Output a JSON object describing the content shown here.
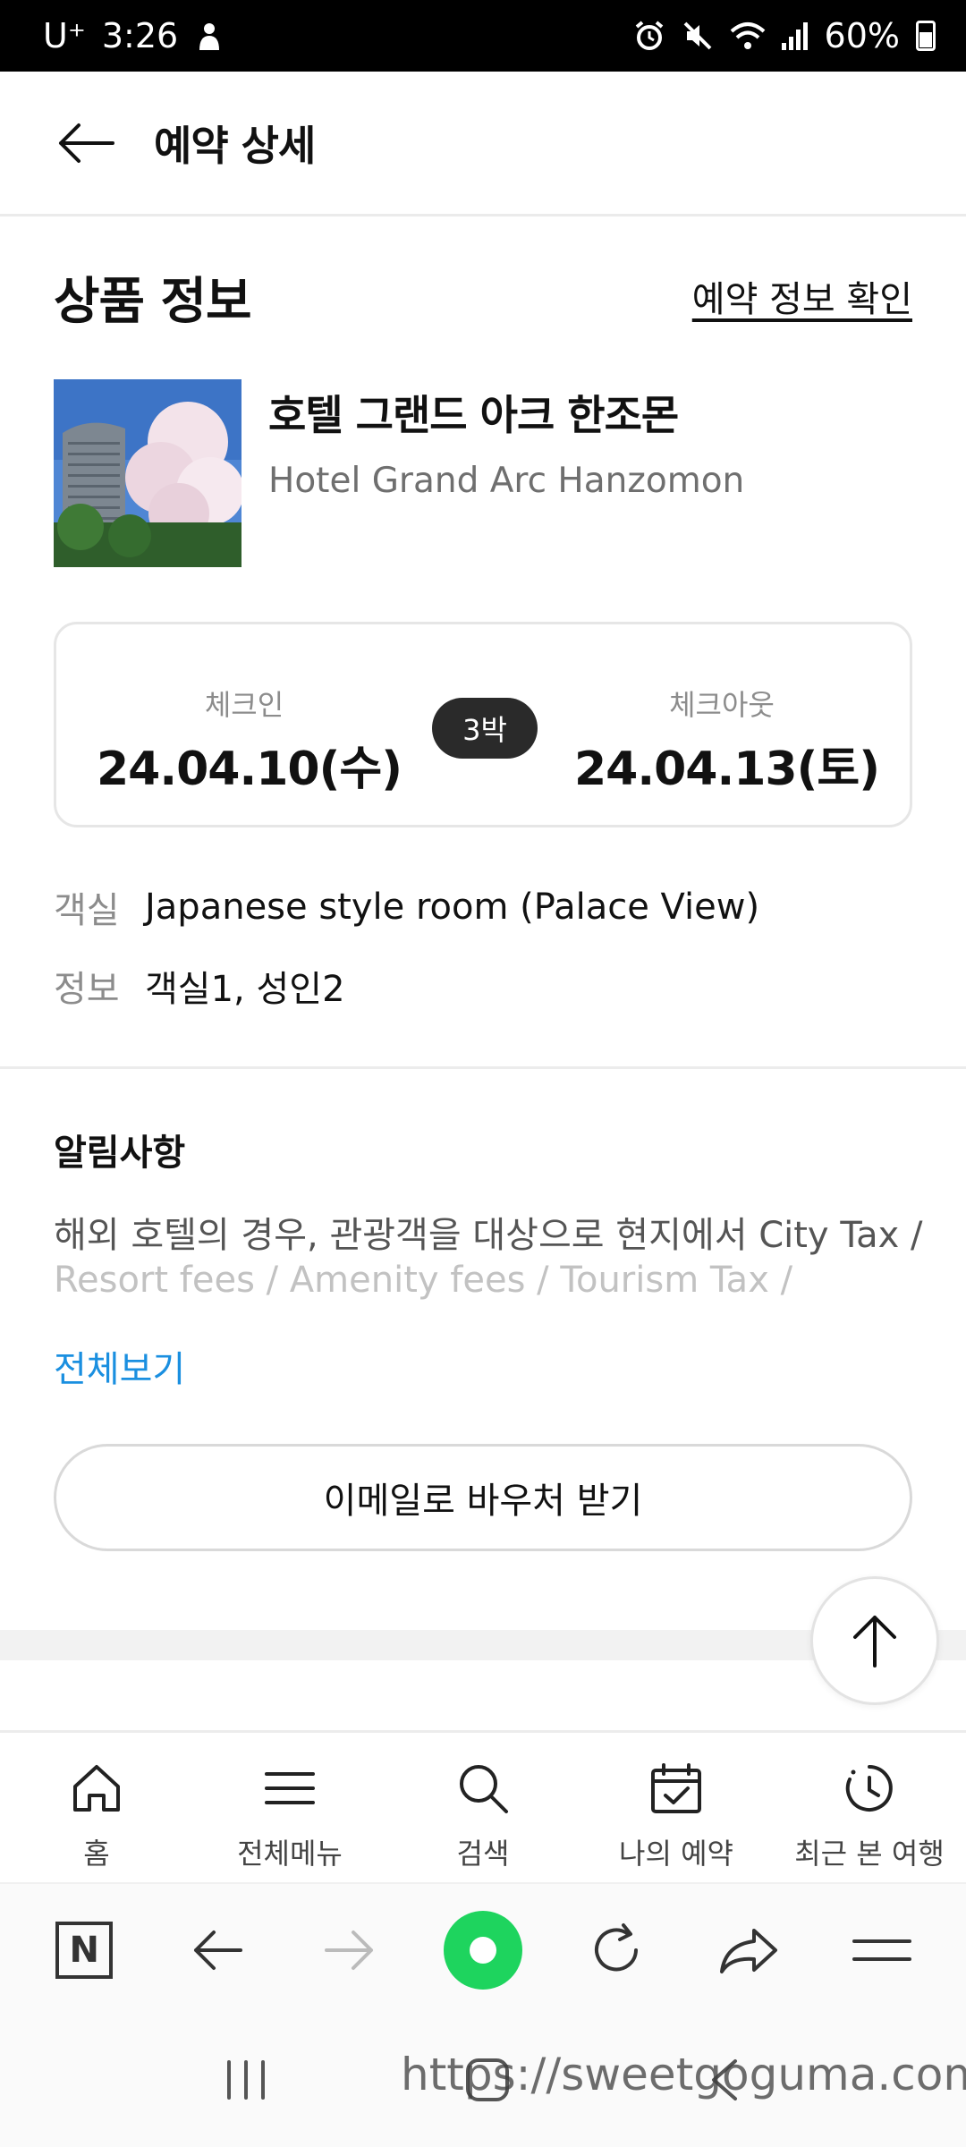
{
  "status_bar": {
    "carrier": "U⁺",
    "time": "3:26",
    "battery": "60%"
  },
  "header": {
    "title": "예약 상세"
  },
  "product": {
    "section_title": "상품 정보",
    "confirm_link": "예약 정보 확인",
    "hotel_name_ko": "호텔 그랜드 아크 한조몬",
    "hotel_name_en": "Hotel Grand Arc Hanzomon"
  },
  "dates": {
    "checkin_label": "체크인",
    "checkin_value": "24.04.10(수)",
    "nights": "3박",
    "checkout_label": "체크아웃",
    "checkout_value": "24.04.13(토)"
  },
  "room": {
    "room_label": "객실",
    "room_value": "Japanese style room (Palace View)",
    "info_label": "정보",
    "info_value": "객실1, 성인2"
  },
  "notice": {
    "title": "알림사항",
    "line1": "해외 호텔의 경우, 관광객을 대상으로 현지에서 City Tax /",
    "line2": "Resort fees / Amenity fees / Tourism Tax /",
    "view_all": "전체보기"
  },
  "voucher_button": "이메일로 바우처 받기",
  "bottom_nav": {
    "items": [
      {
        "label": "홈",
        "icon": "home-icon"
      },
      {
        "label": "전체메뉴",
        "icon": "menu-icon"
      },
      {
        "label": "검색",
        "icon": "search-icon"
      },
      {
        "label": "나의 예약",
        "icon": "calendar-check-icon"
      },
      {
        "label": "최근 본 여행",
        "icon": "clock-icon"
      }
    ]
  },
  "browser_bar": {
    "naver_letter": "N"
  },
  "watermark": "https://sweetgoguma.com",
  "colors": {
    "link_blue": "#1a8fe0",
    "badge_dark": "#2a2a2a",
    "browser_green": "#1ed45e"
  }
}
